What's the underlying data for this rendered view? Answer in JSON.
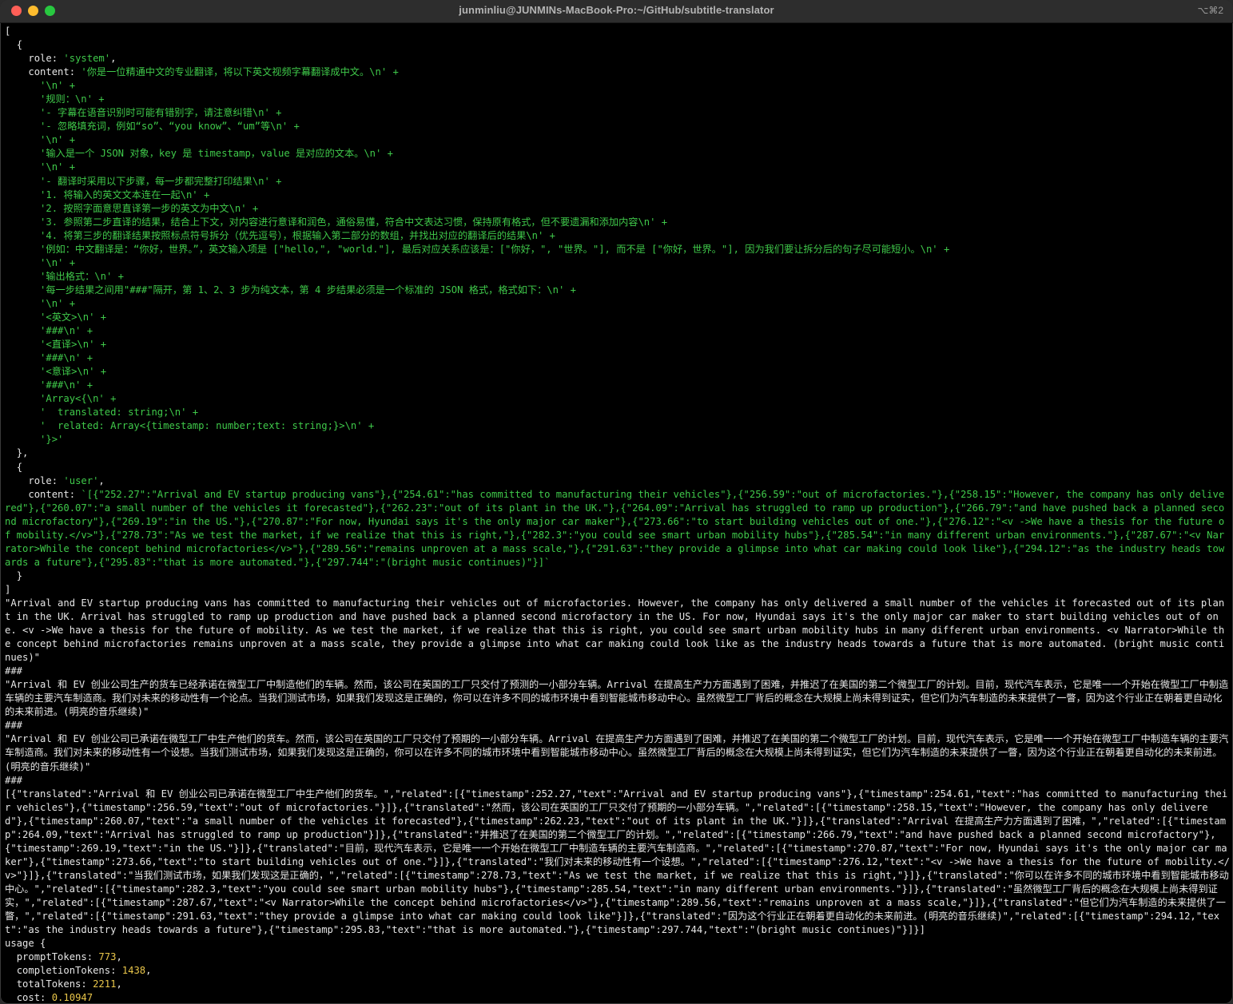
{
  "window": {
    "title": "junminliu@JUNMINs-MacBook-Pro:~/GitHub/subtitle-translator",
    "shortcut": "⌥⌘2"
  },
  "messages": [
    {
      "role_key": "role: ",
      "role": "'system'",
      "content_key": "content: ",
      "lines": [
        "'你是一位精通中文的专业翻译，将以下英文视频字幕翻译成中文。\\n' +",
        "'\\n' +",
        "'规则：\\n' +",
        "'- 字幕在语音识别时可能有错别字，请注意纠错\\n' +",
        "'- 忽略填充词，例如“so”、“you know”、“um”等\\n' +",
        "'\\n' +",
        "'输入是一个 JSON 对象，key 是 timestamp，value 是对应的文本。\\n' +",
        "'\\n' +",
        "'- 翻译时采用以下步骤，每一步都完整打印结果\\n' +",
        "'1. 将输入的英文文本连在一起\\n' +",
        "'2. 按照字面意思直译第一步的英文为中文\\n' +",
        "'3. 参照第二步直译的结果，结合上下文，对内容进行意译和润色，通俗易懂，符合中文表达习惯，保持原有格式，但不要遗漏和添加内容\\n' +",
        "'4. 将第三步的翻译结果按照标点符号拆分（优先逗号），根据输入第二部分的数组，并找出对应的翻译后的结果\\n' +",
        "'例如：中文翻译是：“你好，世界。”，英文输入项是 [\"hello,\", \"world.\"], 最后对应关系应该是：[\"你好，\", \"世界。\"], 而不是 [\"你好，世界。\"], 因为我们要让拆分后的句子尽可能短小。\\n' +",
        "'\\n' +",
        "'输出格式：\\n' +",
        "'每一步结果之间用\"###\"隔开，第 1、2、3 步为纯文本，第 4 步结果必须是一个标准的 JSON 格式，格式如下：\\n' +",
        "'\\n' +",
        "'<英文>\\n' +",
        "'###\\n' +",
        "'<直译>\\n' +",
        "'###\\n' +",
        "'<意译>\\n' +",
        "'###\\n' +",
        "'Array<{\\n' +",
        "'  translated: string;\\n' +",
        "'  related: Array<{timestamp: number;text: string;}>\\n' +",
        "'}>'"
      ]
    },
    {
      "role_key": "role: ",
      "role": "'user'",
      "content_key": "content: ",
      "content": "`[{\"252.27\":\"Arrival and EV startup producing vans\"},{\"254.61\":\"has committed to manufacturing their vehicles\"},{\"256.59\":\"out of microfactories.\"},{\"258.15\":\"However, the company has only delivered\"},{\"260.07\":\"a small number of the vehicles it forecasted\"},{\"262.23\":\"out of its plant in the UK.\"},{\"264.09\":\"Arrival has struggled to ramp up production\"},{\"266.79\":\"and have pushed back a planned second microfactory\"},{\"269.19\":\"in the US.\"},{\"270.87\":\"For now, Hyundai says it's the only major car maker\"},{\"273.66\":\"to start building vehicles out of one.\"},{\"276.12\":\"<v ->We have a thesis for the future of mobility.</v>\"},{\"278.73\":\"As we test the market, if we realize that this is right,\"},{\"282.3\":\"you could see smart urban mobility hubs\"},{\"285.54\":\"in many different urban environments.\"},{\"287.67\":\"<v Narrator>While the concept behind microfactories</v>\"},{\"289.56\":\"remains unproven at a mass scale,\"},{\"291.63\":\"they provide a glimpse into what car making could look like\"},{\"294.12\":\"as the industry heads towards a future\"},{\"295.83\":\"that is more automated.\"},{\"297.744\":\"(bright music continues)\"}]`"
    }
  ],
  "output": {
    "english": "\"Arrival and EV startup producing vans has committed to manufacturing their vehicles out of microfactories. However, the company has only delivered a small number of the vehicles it forecasted out of its plant in the UK. Arrival has struggled to ramp up production and have pushed back a planned second microfactory in the US. For now, Hyundai says it's the only major car maker to start building vehicles out of one. <v ->We have a thesis for the future of mobility. As we test the market, if we realize that this is right, you could see smart urban mobility hubs in many different urban environments. <v Narrator>While the concept behind microfactories remains unproven at a mass scale, they provide a glimpse into what car making could look like as the industry heads towards a future that is more automated. (bright music continues)\"",
    "sep": "###",
    "literal": "\"Arrival 和 EV 创业公司生产的货车已经承诺在微型工厂中制造他们的车辆。然而，该公司在英国的工厂只交付了预测的一小部分车辆。Arrival 在提高生产力方面遇到了困难，并推迟了在美国的第二个微型工厂的计划。目前，现代汽车表示，它是唯一一个开始在微型工厂中制造车辆的主要汽车制造商。我们对未来的移动性有一个论点。当我们测试市场，如果我们发现这是正确的，你可以在许多不同的城市环境中看到智能城市移动中心。虽然微型工厂背后的概念在大规模上尚未得到证实，但它们为汽车制造的未来提供了一瞥，因为这个行业正在朝着更自动化的未来前进。(明亮的音乐继续)\"",
    "free": "\"Arrival 和 EV 创业公司已承诺在微型工厂中生产他们的货车。然而，该公司在英国的工厂只交付了预期的一小部分车辆。Arrival 在提高生产力方面遇到了困难，并推迟了在美国的第二个微型工厂的计划。目前，现代汽车表示，它是唯一一个开始在微型工厂中制造车辆的主要汽车制造商。我们对未来的移动性有一个设想。当我们测试市场，如果我们发现这是正确的，你可以在许多不同的城市环境中看到智能城市移动中心。虽然微型工厂背后的概念在大规模上尚未得到证实，但它们为汽车制造的未来提供了一瞥，因为这个行业正在朝着更自动化的未来前进。(明亮的音乐继续)\"",
    "json": "[{\"translated\":\"Arrival 和 EV 创业公司已承诺在微型工厂中生产他们的货车。\",\"related\":[{\"timestamp\":252.27,\"text\":\"Arrival and EV startup producing vans\"},{\"timestamp\":254.61,\"text\":\"has committed to manufacturing their vehicles\"},{\"timestamp\":256.59,\"text\":\"out of microfactories.\"}]},{\"translated\":\"然而，该公司在英国的工厂只交付了预期的一小部分车辆。\",\"related\":[{\"timestamp\":258.15,\"text\":\"However, the company has only delivered\"},{\"timestamp\":260.07,\"text\":\"a small number of the vehicles it forecasted\"},{\"timestamp\":262.23,\"text\":\"out of its plant in the UK.\"}]},{\"translated\":\"Arrival 在提高生产力方面遇到了困难，\",\"related\":[{\"timestamp\":264.09,\"text\":\"Arrival has struggled to ramp up production\"}]},{\"translated\":\"并推迟了在美国的第二个微型工厂的计划。\",\"related\":[{\"timestamp\":266.79,\"text\":\"and have pushed back a planned second microfactory\"},{\"timestamp\":269.19,\"text\":\"in the US.\"}]},{\"translated\":\"目前，现代汽车表示，它是唯一一个开始在微型工厂中制造车辆的主要汽车制造商。\",\"related\":[{\"timestamp\":270.87,\"text\":\"For now, Hyundai says it's the only major car maker\"},{\"timestamp\":273.66,\"text\":\"to start building vehicles out of one.\"}]},{\"translated\":\"我们对未来的移动性有一个设想。\",\"related\":[{\"timestamp\":276.12,\"text\":\"<v ->We have a thesis for the future of mobility.</v>\"}]},{\"translated\":\"当我们测试市场，如果我们发现这是正确的，\",\"related\":[{\"timestamp\":278.73,\"text\":\"As we test the market, if we realize that this is right,\"}]},{\"translated\":\"你可以在许多不同的城市环境中看到智能城市移动中心。\",\"related\":[{\"timestamp\":282.3,\"text\":\"you could see smart urban mobility hubs\"},{\"timestamp\":285.54,\"text\":\"in many different urban environments.\"}]},{\"translated\":\"虽然微型工厂背后的概念在大规模上尚未得到证实，\",\"related\":[{\"timestamp\":287.67,\"text\":\"<v Narrator>While the concept behind microfactories</v>\"},{\"timestamp\":289.56,\"text\":\"remains unproven at a mass scale,\"}]},{\"translated\":\"但它们为汽车制造的未来提供了一瞥，\",\"related\":[{\"timestamp\":291.63,\"text\":\"they provide a glimpse into what car making could look like\"}]},{\"translated\":\"因为这个行业正在朝着更自动化的未来前进。(明亮的音乐继续)\",\"related\":[{\"timestamp\":294.12,\"text\":\"as the industry heads towards a future\"},{\"timestamp\":295.83,\"text\":\"that is more automated.\"},{\"timestamp\":297.744,\"text\":\"(bright music continues)\"}]}]"
  },
  "usage": {
    "label": "usage {",
    "promptTokens_key": "promptTokens: ",
    "promptTokens": "773",
    "completionTokens_key": "completionTokens: ",
    "completionTokens": "1438",
    "totalTokens_key": "totalTokens: ",
    "totalTokens": "2211",
    "cost_key": "cost: ",
    "cost": "0.10947",
    "comma": ",",
    "close": "}"
  },
  "punct": {
    "open_bracket": "[",
    "close_bracket": "]",
    "open_brace": "{",
    "close_brace": "}",
    "close_brace_comma": "},",
    "comma": ","
  }
}
